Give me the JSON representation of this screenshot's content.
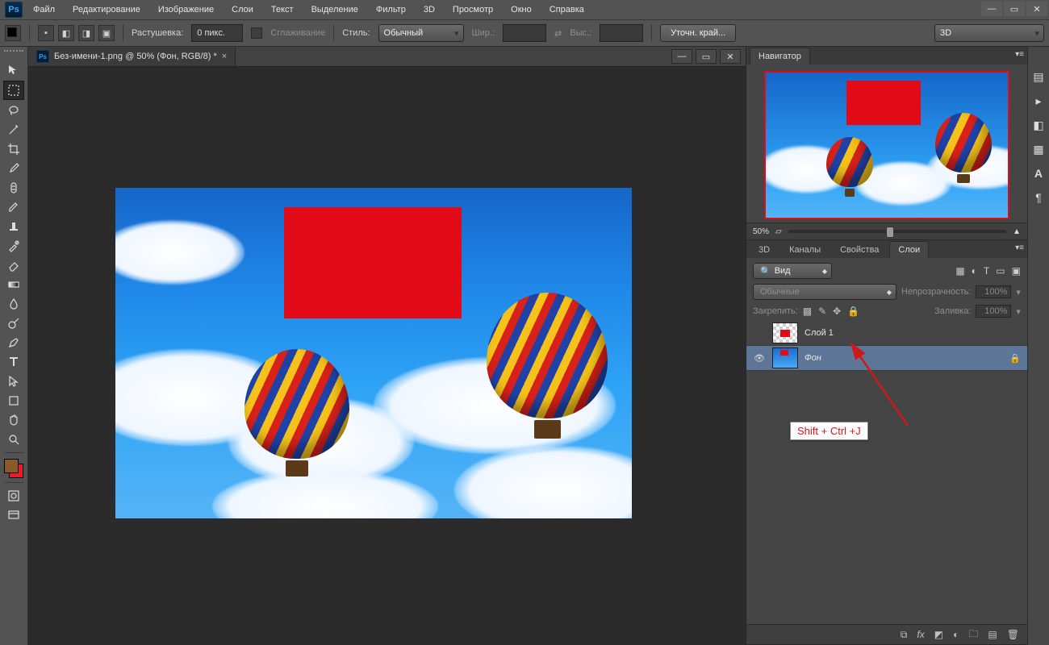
{
  "menubar": {
    "items": [
      "Файл",
      "Редактирование",
      "Изображение",
      "Слои",
      "Текст",
      "Выделение",
      "Фильтр",
      "3D",
      "Просмотр",
      "Окно",
      "Справка"
    ]
  },
  "optionsbar": {
    "feather_label": "Растушевка:",
    "feather_value": "0 пикс.",
    "antialias_label": "Сглаживание",
    "style_label": "Стиль:",
    "style_value": "Обычный",
    "width_label": "Шир.:",
    "height_label": "Выс.:",
    "refine_label": "Уточн. край...",
    "mode_3d": "3D"
  },
  "doc": {
    "tab_title": "Без-имени-1.png @ 50% (Фон, RGB/8) *"
  },
  "navigator": {
    "tab": "Навигатор",
    "zoom": "50%"
  },
  "layerspanel": {
    "tabs": [
      "3D",
      "Каналы",
      "Свойства",
      "Слои"
    ],
    "kind": "Вид",
    "blend": "Обычные",
    "opacity_label": "Непрозрачность:",
    "opacity_value": "100%",
    "lock_label": "Закрепить:",
    "fill_label": "Заливка:",
    "fill_value": "100%",
    "layers": [
      {
        "name": "Слой 1",
        "visible": false,
        "locked": false,
        "thumb": "trans"
      },
      {
        "name": "Фон",
        "visible": true,
        "locked": true,
        "thumb": "sky"
      }
    ]
  },
  "annotation": {
    "text": "Shift + Ctrl +J"
  }
}
